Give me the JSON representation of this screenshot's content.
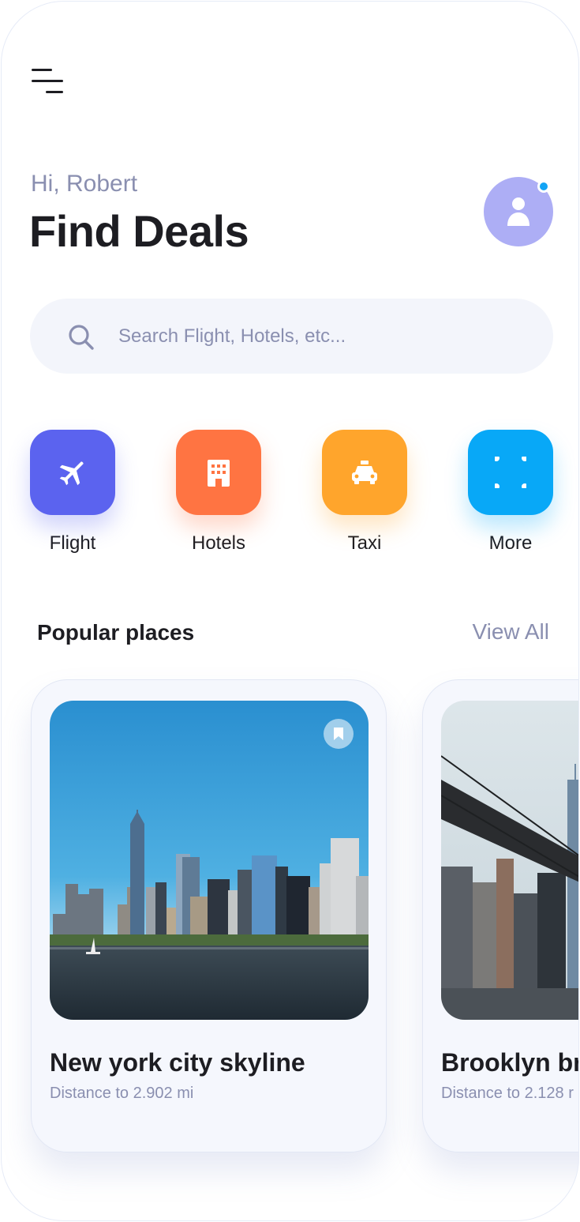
{
  "header": {
    "greeting": "Hi, Robert",
    "title": "Find Deals"
  },
  "search": {
    "placeholder": "Search Flight, Hotels, etc...",
    "value": ""
  },
  "categories": [
    {
      "label": "Flight",
      "icon": "airplane-icon",
      "color": "#5b63ef"
    },
    {
      "label": "Hotels",
      "icon": "building-icon",
      "color": "#ff7442"
    },
    {
      "label": "Taxi",
      "icon": "taxi-icon",
      "color": "#ffa52c"
    },
    {
      "label": "More",
      "icon": "grid-dots-icon",
      "color": "#08a8f7"
    }
  ],
  "popular": {
    "title": "Popular places",
    "view_all": "View All",
    "places": [
      {
        "name": "New york city skyline",
        "distance": "Distance to 2.902 mi"
      },
      {
        "name": "Brooklyn br",
        "distance": "Distance to 2.128 r"
      }
    ]
  },
  "colors": {
    "text_primary": "#1d1d22",
    "text_secondary": "#8a8fb0",
    "avatar_bg": "#adaef5",
    "notification_dot": "#12a4f5"
  }
}
